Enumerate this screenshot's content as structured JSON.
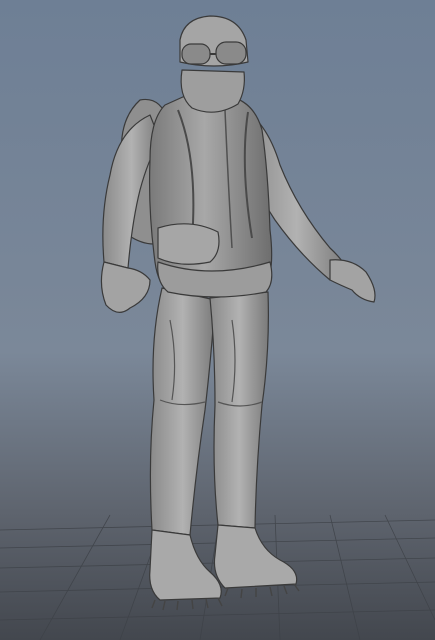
{
  "viewport": {
    "panel": "3d-viewport",
    "shading": "smooth-shaded-untextured",
    "grid_visible": true,
    "colors": {
      "background_top": "#6d7f95",
      "background_mid": "#7d8a99",
      "background_bottom": "#4a4f57",
      "grid_line": "#40444a",
      "model_base": "#8e8e8e",
      "model_light": "#b3b3b3",
      "model_dark": "#555555",
      "wireframe_edge": "#3a3a3a"
    }
  },
  "model": {
    "subject": "character-sculpt",
    "pose": "a-pose",
    "parts": [
      "helmet",
      "goggles",
      "face-mask",
      "jacket",
      "backpack",
      "pouch",
      "trousers",
      "boots",
      "crampons"
    ]
  }
}
